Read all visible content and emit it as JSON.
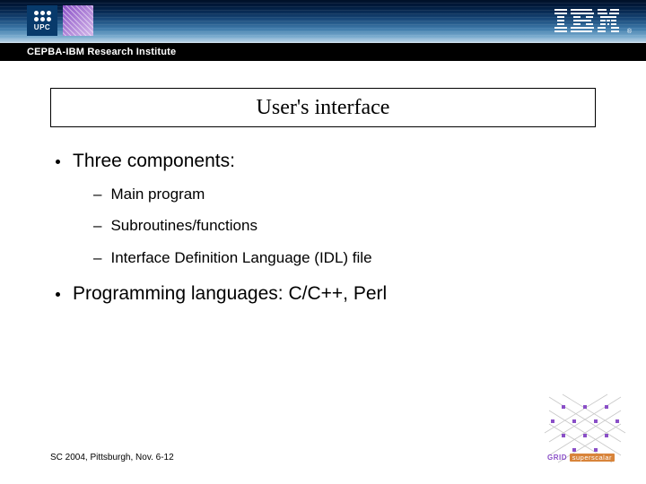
{
  "header": {
    "upc_label": "UPC",
    "institute": "CEPBA-IBM Research Institute",
    "ibm_brand": "IBM",
    "registered": "®"
  },
  "title": "User's interface",
  "bullets": [
    {
      "text": "Three components:",
      "children": [
        "Main program",
        "Subroutines/functions",
        "Interface Definition Language (IDL) file"
      ]
    },
    {
      "text": "Programming languages: C/C++, Perl",
      "children": []
    }
  ],
  "footer": "SC 2004, Pittsburgh, Nov. 6-12",
  "corner": {
    "line1": "GRID",
    "line2": "superscalar"
  }
}
